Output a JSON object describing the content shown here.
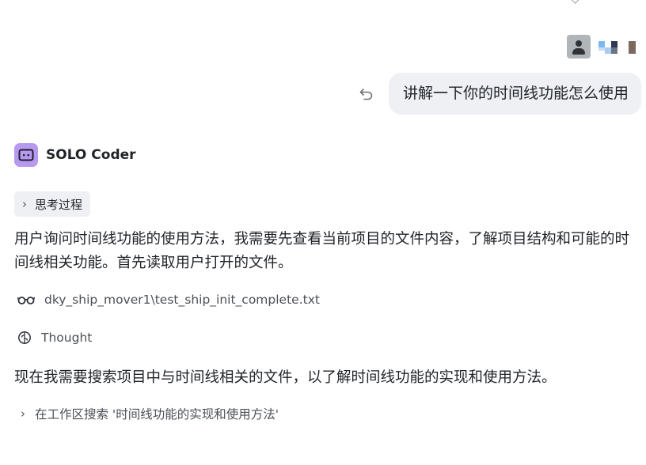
{
  "user": {
    "message": "讲解一下你的时间线功能怎么使用"
  },
  "agent": {
    "name": "SOLO Coder",
    "thinking_label": "思考过程",
    "paragraph_1": "用户询问时间线功能的使用方法，我需要先查看当前项目的文件内容，了解项目结构和可能的时间线相关功能。首先读取用户打开的文件。",
    "file_read": "dky_ship_mover1\\test_ship_init_complete.txt",
    "thought_label": "Thought",
    "paragraph_2": "现在我需要搜索项目中与时间线相关的文件，以了解时间线功能的实现和使用方法。",
    "search_step": "在工作区搜索 '时间线功能的实现和使用方法'"
  },
  "icons": {
    "undo": "undo-icon",
    "avatar": "user-avatar-icon",
    "agent_logo": "robot-icon",
    "thinking_chevron": "chevron-right-icon",
    "read_file": "glasses-icon",
    "thought": "brain-icon",
    "search_chevron": "chevron-right-icon"
  },
  "colors": {
    "bubble_bg": "#eef0f3",
    "agent_logo_bg": "#b79af0",
    "text_primary": "#1f2328",
    "text_secondary": "#4b5056"
  }
}
